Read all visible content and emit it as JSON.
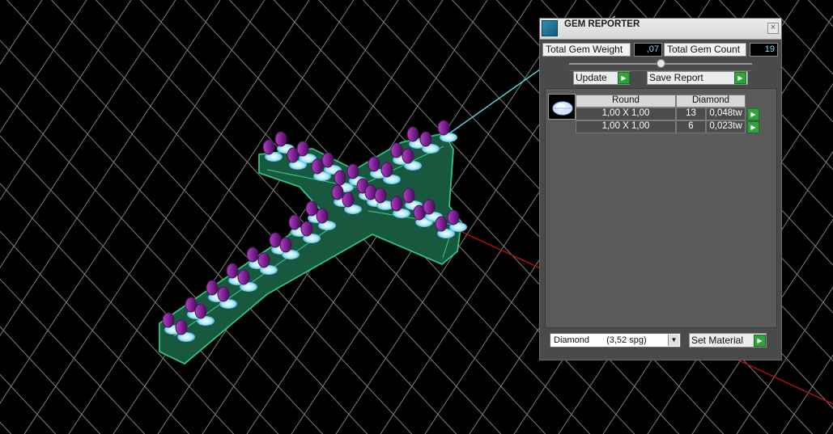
{
  "panel": {
    "title": "GEM REPORTER",
    "close_glyph": "×",
    "total_weight_label": "Total Gem Weight",
    "total_weight_value": ",07",
    "total_count_label": "Total Gem Count",
    "total_count_value": "19",
    "update_label": "Update",
    "save_report_label": "Save Report",
    "table": {
      "headers": [
        "Round",
        "Diamond"
      ],
      "rows": [
        {
          "size": "1,00 X 1,00",
          "count": "13",
          "weight": "0,048tw"
        },
        {
          "size": "1,00 X 1,00",
          "count": "6",
          "weight": "0,023tw"
        }
      ]
    },
    "material_select_value": "Diamond",
    "material_select_spg": "(3,52 spg)",
    "set_material_label": "Set Material"
  },
  "colors": {
    "background": "#000000",
    "panel": "#4a4a4a",
    "grid": "#7e7e7e",
    "axis_x": "#b10f0f",
    "axis_y": "#54d0d6",
    "model_green": "#18583f",
    "model_edge": "#32c27f",
    "gem_purple": "#7b1f8c",
    "seat_blue": "#b8f4ff",
    "accent_green": "#2fa43a"
  }
}
